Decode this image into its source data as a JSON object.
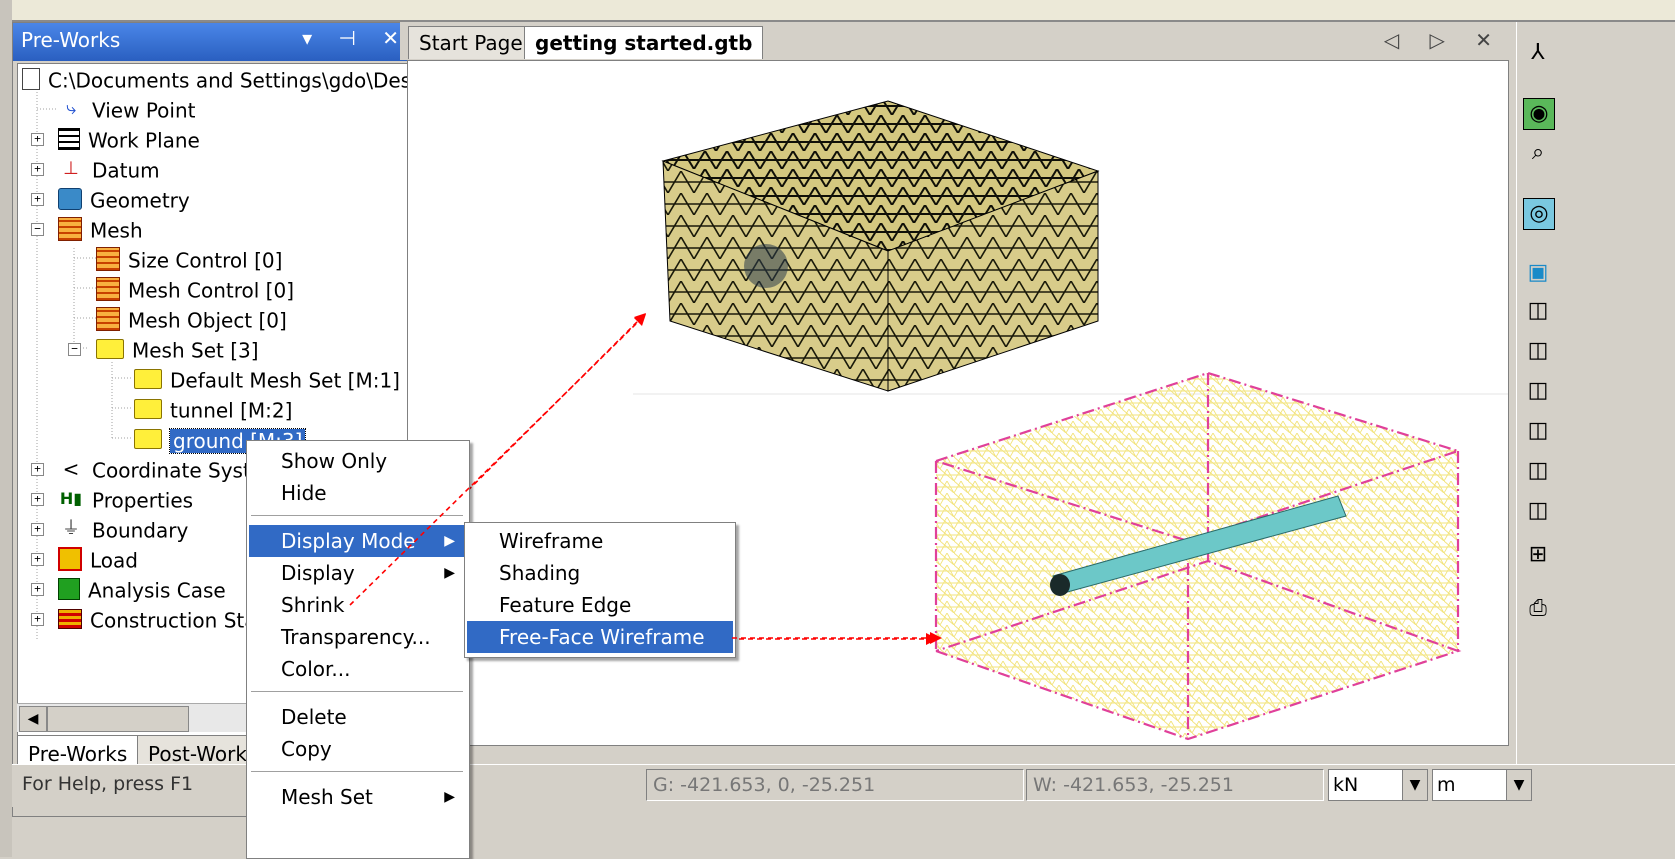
{
  "left_panel": {
    "title": "Pre-Works",
    "title_buttons": "▾ ⊣ ✕",
    "tree": [
      {
        "label": "C:\\Documents and Settings\\gdo\\Des",
        "icon": "document-icon"
      },
      {
        "label": "View Point",
        "icon": "viewpoint-icon"
      },
      {
        "label": "Work Plane",
        "icon": "grid-icon"
      },
      {
        "label": "Datum",
        "icon": "axis-icon"
      },
      {
        "label": "Geometry",
        "icon": "geometry-icon"
      },
      {
        "label": "Mesh",
        "icon": "mesh-icon"
      },
      {
        "label": "Size Control [0]",
        "icon": "mesh-control-icon"
      },
      {
        "label": "Mesh Control [0]",
        "icon": "mesh-control-icon"
      },
      {
        "label": "Mesh Object [0]",
        "icon": "mesh-icon"
      },
      {
        "label": "Mesh Set [3]",
        "icon": "folder-icon"
      },
      {
        "label": "Default Mesh Set [M:1]",
        "icon": "folder-icon"
      },
      {
        "label": "tunnel [M:2]",
        "icon": "folder-icon"
      },
      {
        "label": "ground [M:3]",
        "icon": "folder-icon"
      },
      {
        "label": "Coordinate Syste",
        "icon": "coordinate-icon"
      },
      {
        "label": "Properties",
        "icon": "properties-icon"
      },
      {
        "label": "Boundary",
        "icon": "boundary-icon"
      },
      {
        "label": "Load",
        "icon": "load-icon"
      },
      {
        "label": "Analysis Case",
        "icon": "analysis-icon"
      },
      {
        "label": "Construction Stag",
        "icon": "construction-icon"
      }
    ],
    "tabs": [
      "Pre-Works",
      "Post-Works"
    ]
  },
  "doc_tabs": [
    "Start Page",
    "getting started.gtb"
  ],
  "doc_nav": "◁ ▷ ✕",
  "context_menu": {
    "items": [
      "Show Only",
      "Hide",
      "Display Mode",
      "Display",
      "Shrink",
      "Transparency...",
      "Color...",
      "Delete",
      "Copy",
      "Mesh Set"
    ]
  },
  "submenu": {
    "items": [
      "Wireframe",
      "Shading",
      "Feature Edge",
      "Free-Face Wireframe"
    ]
  },
  "status": {
    "help": "For Help, press F1",
    "global_coord": "G: -421.653, 0, -25.251",
    "work_coord": "W: -421.653, -25.251",
    "force_unit": "kN",
    "length_unit": "m"
  },
  "toolbar": [
    "axis-triad-icon",
    "zoom-fit-icon",
    "zoom-window-icon",
    "zoom-all-icon",
    "view-iso-icon",
    "view-front-icon",
    "view-back-icon",
    "view-left-icon",
    "view-right-icon",
    "view-top-icon",
    "view-bottom-icon",
    "view-grid-icon",
    "camera-icon"
  ],
  "colors": {
    "selection": "#316ac5",
    "mesh_solid": "#d8cc8a",
    "wireframe": "#f5e97a",
    "bounding_box": "#e0409a",
    "arrow": "#ff0000"
  }
}
